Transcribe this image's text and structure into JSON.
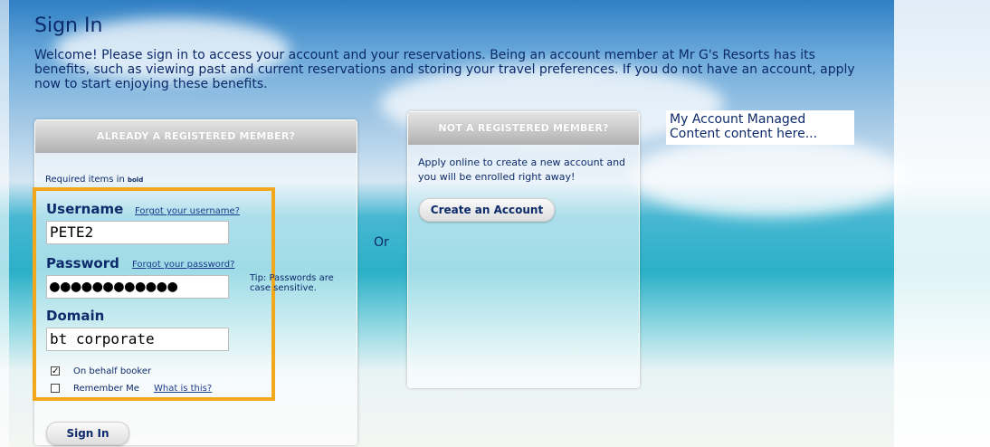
{
  "page": {
    "title": "Sign In",
    "intro": "Welcome! Please sign in to access your account and your reservations. Being an account member at Mr G's Resorts has its benefits, such as viewing past and current reservations and storing your travel preferences. If you do not have an account, apply now to start enjoying these benefits."
  },
  "registered": {
    "header": "ALREADY A REGISTERED MEMBER?",
    "required_text": "Required items in ",
    "required_bold": "bold",
    "username_label": "Username",
    "forgot_username": "Forgot your username?",
    "username_value": "PETE2",
    "password_label": "Password",
    "forgot_password": "Forgot your password?",
    "password_value": "●●●●●●●●●●●●",
    "tip": "Tip: Passwords are case sensitive.",
    "domain_label": "Domain",
    "domain_value": "bt corporate",
    "on_behalf_label": "On behalf booker",
    "on_behalf_checked": true,
    "remember_label": "Remember Me",
    "remember_checked": false,
    "what_is_this": "What is this?",
    "sign_in_button": "Sign In"
  },
  "separator": "Or",
  "new_member": {
    "header": "NOT A REGISTERED MEMBER?",
    "text": "Apply online to create a new account and you will be enrolled right away!",
    "create_button": "Create an Account"
  },
  "managed_content": "My Account Managed Content content here...",
  "icons": {
    "checkbox_checked": "checkmark-icon"
  },
  "colors": {
    "text": "#0d2a6b",
    "highlight": "#f2a81d"
  }
}
